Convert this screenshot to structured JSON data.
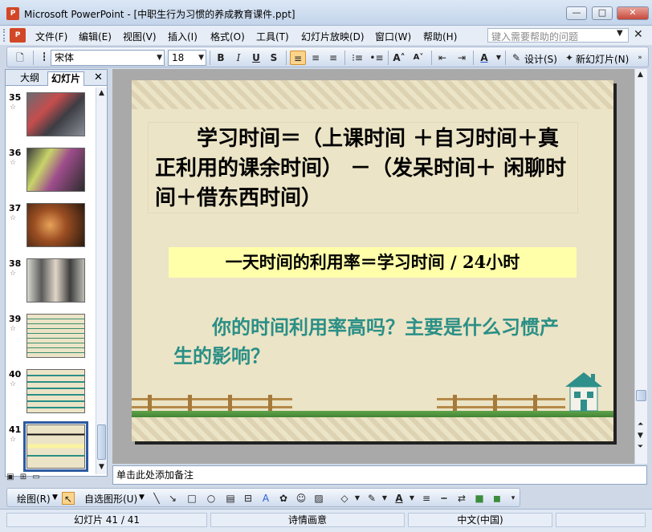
{
  "window": {
    "title": "Microsoft PowerPoint - [中职生行为习惯的养成教育课件.ppt]",
    "app_icon": "P",
    "minimize": "—",
    "maximize": "□",
    "close": "✕"
  },
  "menu": {
    "items": [
      "文件(F)",
      "编辑(E)",
      "视图(V)",
      "插入(I)",
      "格式(O)",
      "工具(T)",
      "幻灯片放映(D)",
      "窗口(W)",
      "帮助(H)"
    ],
    "help_placeholder": "键入需要帮助的问题",
    "doc_close": "✕"
  },
  "toolbar": {
    "font_name": "宋体",
    "font_size": "18",
    "bold": "B",
    "italic": "I",
    "underline": "U",
    "shadow": "S",
    "design_label": "设计(S)",
    "new_slide_label": "新幻灯片(N)"
  },
  "left_pane": {
    "tab_outline": "大纲",
    "tab_slides": "幻灯片",
    "close": "✕",
    "slides": [
      {
        "num": "35",
        "kind": "photo"
      },
      {
        "num": "36",
        "kind": "photo"
      },
      {
        "num": "37",
        "kind": "photo"
      },
      {
        "num": "38",
        "kind": "photo"
      },
      {
        "num": "39",
        "kind": "text"
      },
      {
        "num": "40",
        "kind": "text"
      },
      {
        "num": "41",
        "kind": "text",
        "selected": true
      }
    ],
    "star": "☆"
  },
  "slide": {
    "text1": "学习时间＝（上课时间 ＋自习时间＋真正利用的课余时间） －（发呆时间＋ 闲聊时间＋借东西时间）",
    "text2": "一天时间的利用率＝学习时间 / 24小时",
    "text3": "你的时间利用率高吗？主要是什么习惯产生的影响？",
    "text3_color": "#2a8f86"
  },
  "notes": {
    "placeholder": "单击此处添加备注"
  },
  "drawbar": {
    "draw_label": "绘图(R)",
    "autoshapes_label": "自选图形(U)"
  },
  "status": {
    "slide_pos": "幻灯片 41 / 41",
    "design": "诗情画意",
    "language": "中文(中国)"
  }
}
